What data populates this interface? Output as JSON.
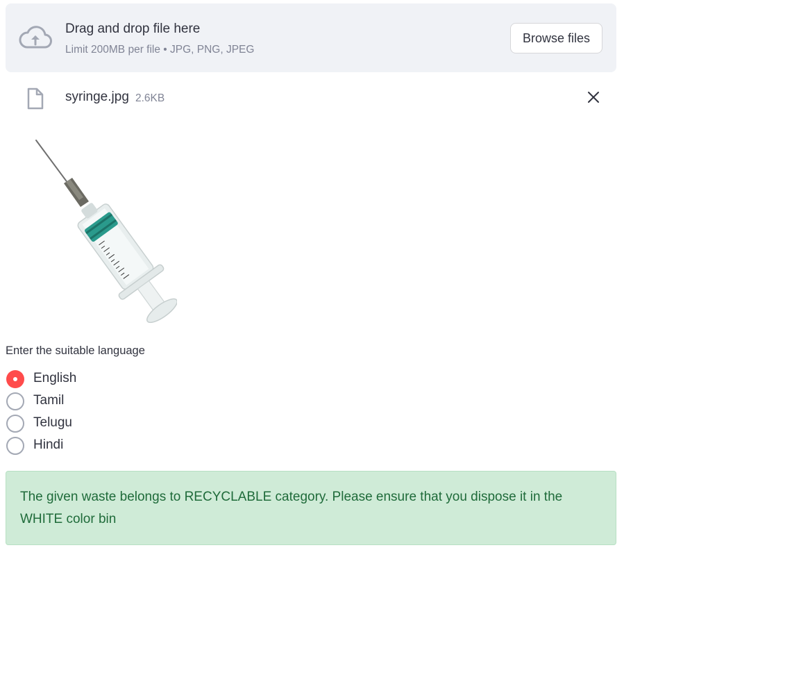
{
  "uploader": {
    "title": "Drag and drop file here",
    "subtitle": "Limit 200MB per file • JPG, PNG, JPEG",
    "browse_label": "Browse files",
    "icon": "cloud-upload-icon"
  },
  "file": {
    "name": "syringe.jpg",
    "size": "2.6KB",
    "icon": "file-icon",
    "remove_icon": "close-icon"
  },
  "preview": {
    "subject": "syringe"
  },
  "language": {
    "label": "Enter the suitable language",
    "options": [
      {
        "label": "English",
        "checked": true
      },
      {
        "label": "Tamil",
        "checked": false
      },
      {
        "label": "Telugu",
        "checked": false
      },
      {
        "label": "Hindi",
        "checked": false
      }
    ]
  },
  "result": {
    "message": "The given waste belongs to RECYCLABLE category. Please ensure that you dispose it in the WHITE color bin"
  },
  "colors": {
    "accent": "#ff4b4b",
    "success_bg": "#cfebd7",
    "success_text": "#1f6b3a",
    "dropzone_bg": "#f0f2f6"
  }
}
